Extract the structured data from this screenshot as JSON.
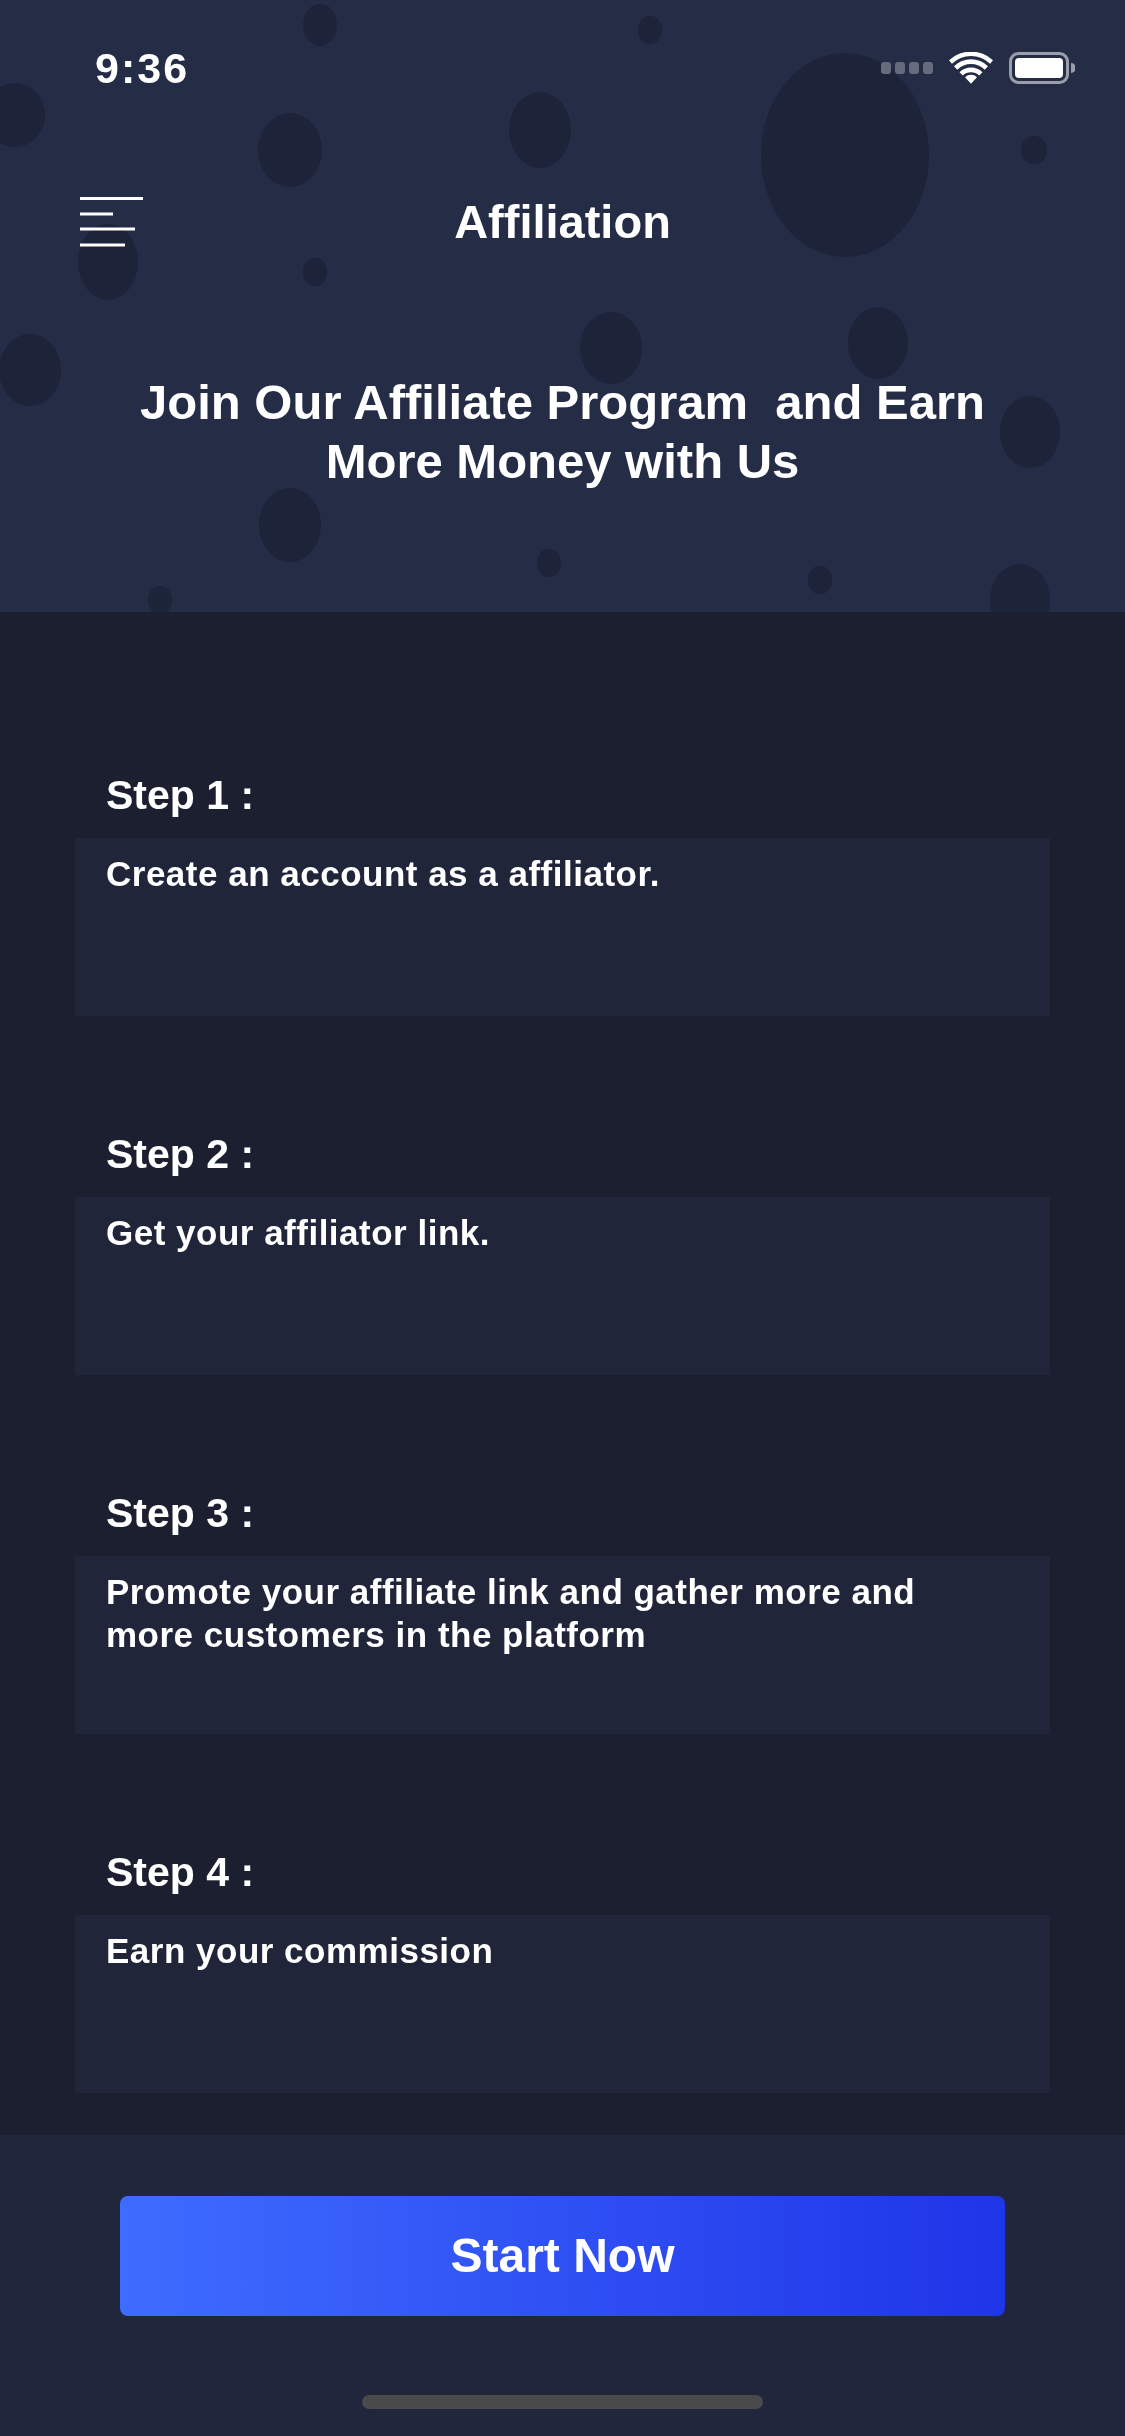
{
  "status_bar": {
    "time": "9:36"
  },
  "header": {
    "title": "Affiliation",
    "headline": "Join Our Affiliate Program  and Earn More Money with Us"
  },
  "steps": [
    {
      "label": "Step 1 :",
      "description": "Create an account as a affiliator."
    },
    {
      "label": "Step 2 :",
      "description": "Get your affiliator link."
    },
    {
      "label": "Step 3 :",
      "description": "Promote your affiliate link and gather more and more customers in the platform"
    },
    {
      "label": "Step 4 :",
      "description": "Earn your commission"
    }
  ],
  "button": {
    "label": "Start Now"
  }
}
